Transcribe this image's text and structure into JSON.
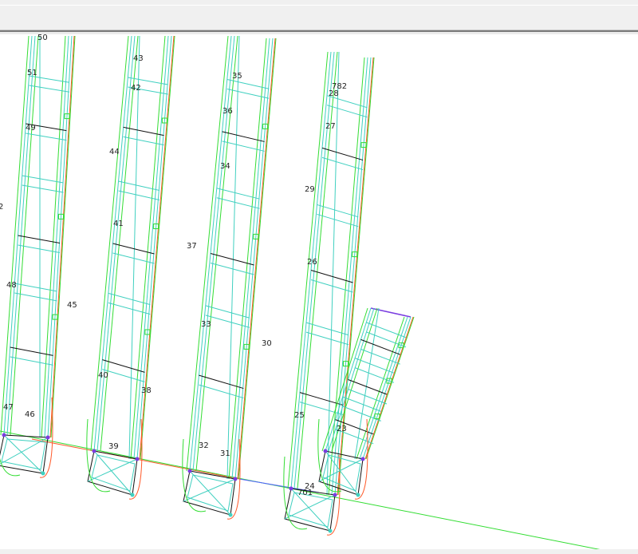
{
  "viewport": {
    "labels": [
      "50",
      "51",
      "49",
      "2",
      "48",
      "47",
      "46",
      "45",
      "44",
      "43",
      "42",
      "41",
      "40",
      "39",
      "38",
      "37",
      "36",
      "35",
      "34",
      "33",
      "32",
      "31",
      "30",
      "782",
      "28",
      "27",
      "29",
      "26",
      "25",
      "24",
      "701",
      "23"
    ]
  },
  "colors": {
    "green": "#33dd33",
    "cyan": "#40d0c0",
    "red": "#ff5a2a",
    "black": "#111111",
    "violet": "#7a3de0",
    "blue": "#5060ff"
  }
}
